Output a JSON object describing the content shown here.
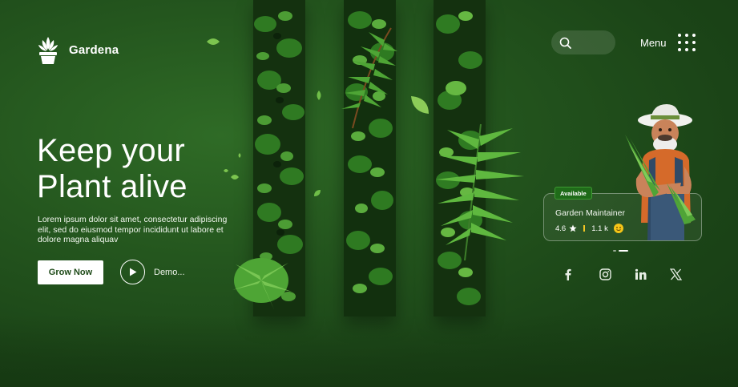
{
  "brand": {
    "name": "Gardena",
    "icon": "potted-plant-icon"
  },
  "header": {
    "search": {
      "icon": "search-icon",
      "placeholder": ""
    },
    "menu": {
      "label": "Menu",
      "icon": "grid-dots-icon"
    }
  },
  "hero": {
    "title_line1": "Keep your",
    "title_line2": "Plant alive",
    "description": "Lorem ipsum dolor sit amet, consectetur adipiscing elit, sed do eiusmod tempor incididunt ut labore et dolore magna aliquav",
    "primary_button": "Grow Now",
    "demo_label": "Demo..."
  },
  "card": {
    "badge": "Available",
    "title": "Garden Maintainer",
    "rating": "4.6",
    "rating_icon": "star-icon",
    "count": "1.1 k",
    "count_icon": "smiley-icon"
  },
  "socials": [
    "facebook-icon",
    "instagram-icon",
    "linkedin-icon",
    "x-icon"
  ],
  "colors": {
    "background": "#24561e",
    "button_bg": "#ffffff",
    "button_text": "#1e4a18",
    "badge": "#1f6b19",
    "star": "#f5c518"
  }
}
